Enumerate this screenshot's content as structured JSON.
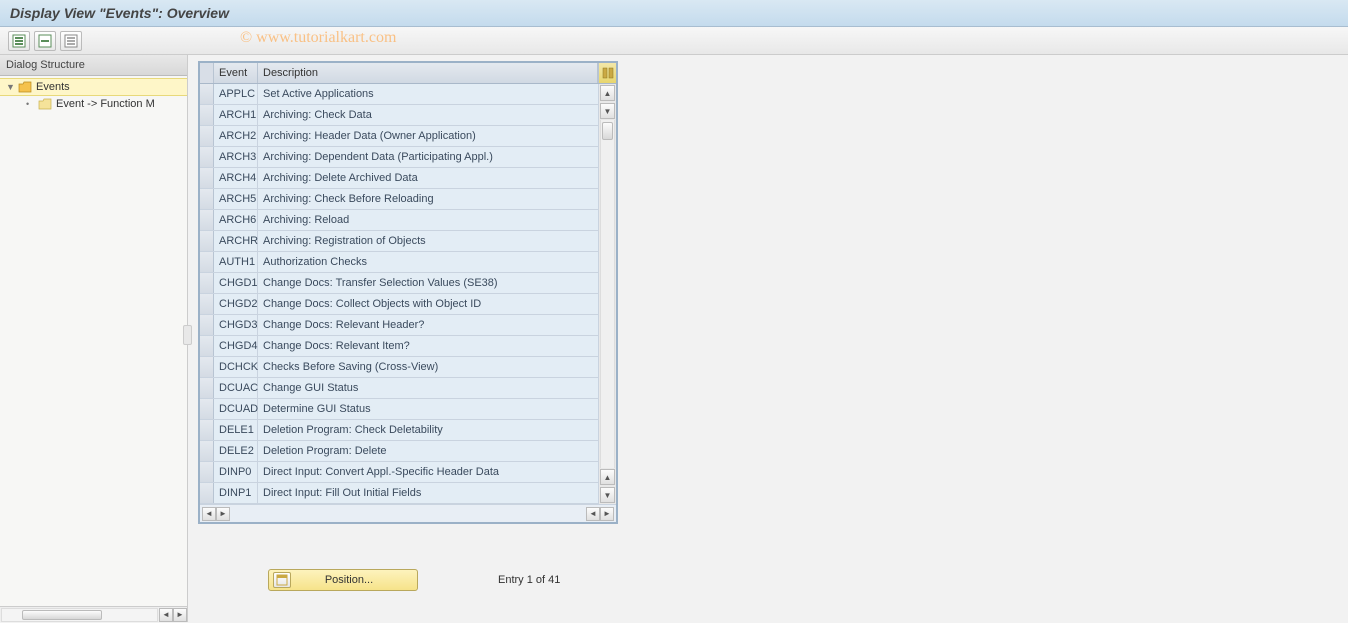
{
  "title": "Display View \"Events\": Overview",
  "watermark": "© www.tutorialkart.com",
  "tree": {
    "header": "Dialog Structure",
    "root": {
      "label": "Events",
      "expanded": true
    },
    "child": {
      "label": "Event -> Function M"
    }
  },
  "table": {
    "headers": {
      "event": "Event",
      "description": "Description"
    },
    "rows": [
      {
        "event": "APPLC",
        "desc": "Set Active Applications"
      },
      {
        "event": "ARCH1",
        "desc": "Archiving: Check Data"
      },
      {
        "event": "ARCH2",
        "desc": "Archiving: Header Data (Owner Application)"
      },
      {
        "event": "ARCH3",
        "desc": "Archiving: Dependent Data (Participating Appl.)"
      },
      {
        "event": "ARCH4",
        "desc": "Archiving: Delete Archived Data"
      },
      {
        "event": "ARCH5",
        "desc": "Archiving: Check Before Reloading"
      },
      {
        "event": "ARCH6",
        "desc": "Archiving: Reload"
      },
      {
        "event": "ARCHR",
        "desc": "Archiving: Registration of Objects"
      },
      {
        "event": "AUTH1",
        "desc": "Authorization Checks"
      },
      {
        "event": "CHGD1",
        "desc": "Change Docs: Transfer Selection Values (SE38)"
      },
      {
        "event": "CHGD2",
        "desc": "Change Docs: Collect Objects with Object ID"
      },
      {
        "event": "CHGD3",
        "desc": "Change Docs: Relevant Header?"
      },
      {
        "event": "CHGD4",
        "desc": "Change Docs: Relevant Item?"
      },
      {
        "event": "DCHCK",
        "desc": "Checks Before Saving (Cross-View)"
      },
      {
        "event": "DCUAC",
        "desc": "Change GUI Status"
      },
      {
        "event": "DCUAD",
        "desc": "Determine GUI Status"
      },
      {
        "event": "DELE1",
        "desc": "Deletion Program: Check Deletability"
      },
      {
        "event": "DELE2",
        "desc": "Deletion Program: Delete"
      },
      {
        "event": "DINP0",
        "desc": "Direct Input: Convert Appl.-Specific Header Data"
      },
      {
        "event": "DINP1",
        "desc": "Direct Input: Fill Out Initial Fields"
      }
    ]
  },
  "footer": {
    "position_label": "Position...",
    "entry_info": "Entry 1 of 41"
  }
}
